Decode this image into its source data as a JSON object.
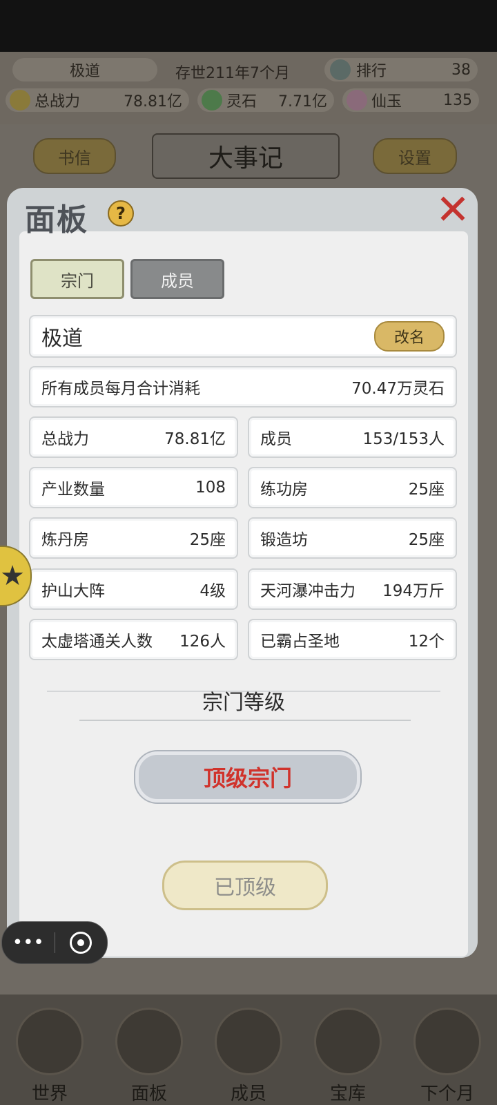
{
  "top_bar": {
    "sect_name": "极道",
    "time": "存世211年7个月",
    "rank_label": "排行",
    "rank_value": "38",
    "power_label": "总战力",
    "power_value": "78.81亿",
    "stone_label": "灵石",
    "stone_value": "7.71亿",
    "jade_label": "仙玉",
    "jade_value": "135"
  },
  "header_buttons": {
    "letters": "书信",
    "title": "大事记",
    "settings": "设置"
  },
  "panel": {
    "title": "面板",
    "help": "?",
    "close": "✕",
    "tabs": [
      "宗门",
      "成员"
    ],
    "sect_name": "极道",
    "rename": "改名",
    "monthly_cost_label": "所有成员每月合计消耗",
    "monthly_cost_value": "70.47万灵石",
    "stats": [
      {
        "label": "总战力",
        "value": "78.81亿"
      },
      {
        "label": "成员",
        "value": "153/153人"
      },
      {
        "label": "产业数量",
        "value": "108"
      },
      {
        "label": "练功房",
        "value": "25座"
      },
      {
        "label": "炼丹房",
        "value": "25座"
      },
      {
        "label": "锻造坊",
        "value": "25座"
      },
      {
        "label": "护山大阵",
        "value": "4级"
      },
      {
        "label": "天河瀑冲击力",
        "value": "194万斤"
      },
      {
        "label": "太虚塔通关人数",
        "value": "126人"
      },
      {
        "label": "已霸占圣地",
        "value": "12个"
      }
    ],
    "level_title": "宗门等级",
    "level_value": "顶级宗门",
    "max_button": "已顶级"
  },
  "bottom_nav": [
    "世界",
    "面板",
    "成员",
    "宝库",
    "下个月"
  ],
  "mini_program": {
    "more": "•••"
  },
  "colors": {
    "accent_red": "#d0332c",
    "gold": "#d9b866",
    "panel_bg": "#efefef"
  }
}
